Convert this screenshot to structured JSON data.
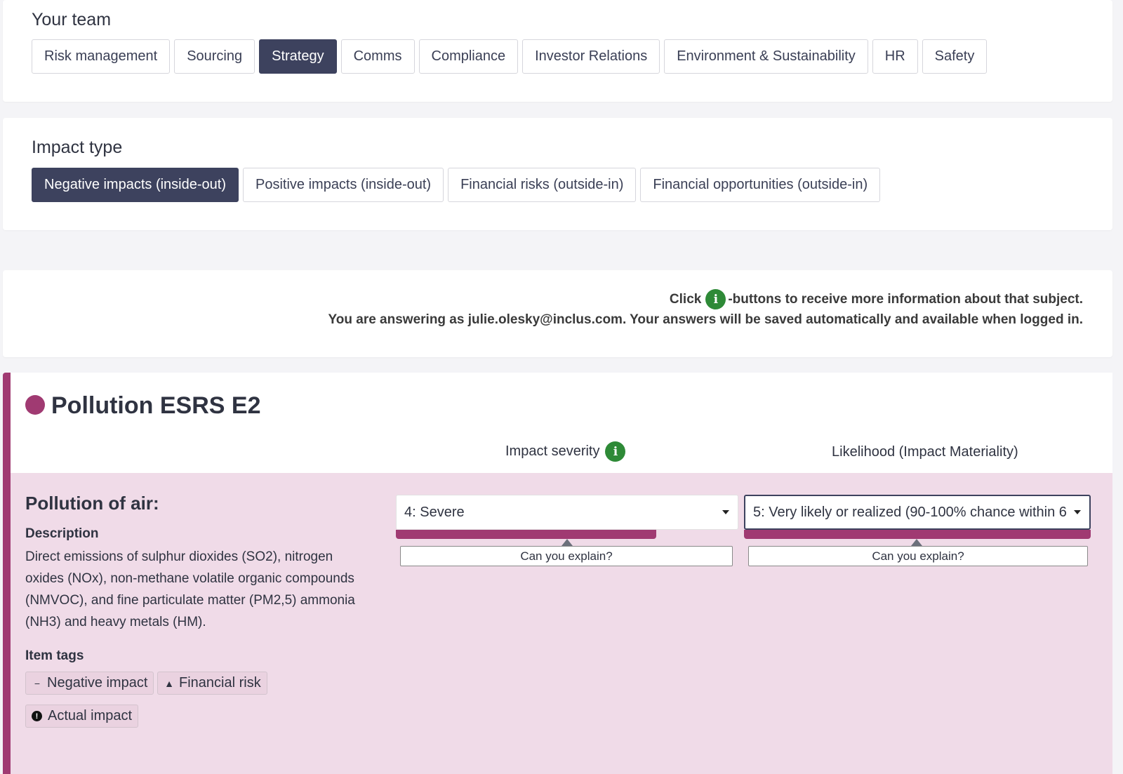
{
  "team": {
    "title": "Your team",
    "buttons": [
      "Risk management",
      "Sourcing",
      "Strategy",
      "Comms",
      "Compliance",
      "Investor Relations",
      "Environment & Sustainability",
      "HR",
      "Safety"
    ],
    "active": "Strategy"
  },
  "impact_type": {
    "title": "Impact type",
    "buttons": [
      "Negative impacts (inside-out)",
      "Positive impacts (inside-out)",
      "Financial risks (outside-in)",
      "Financial opportunities (outside-in)"
    ],
    "active": "Negative impacts (inside-out)"
  },
  "notice": {
    "line1_prefix": "Click",
    "line1_suffix": "-buttons to receive more information about that subject.",
    "line2": "You are answering as julie.olesky@inclus.com. Your answers will be saved automatically and available when logged in."
  },
  "topic": {
    "title": "Pollution ESRS E2",
    "color": "#a03a72",
    "col_severity": "Impact severity",
    "col_likelihood": "Likelihood (Impact Materiality)"
  },
  "item": {
    "title": "Pollution of air:",
    "description_label": "Description",
    "description": "Direct emissions of sulphur dioxides (SO2), nitrogen oxides (NOx), non-methane volatile organic compounds (NMVOC), and fine particulate matter (PM2,5) ammonia (NH3) and heavy metals (HM).",
    "tags_label": "Item tags",
    "tags": [
      {
        "label": "Negative impact",
        "icon": "minus-icon"
      },
      {
        "label": "Financial risk",
        "icon": "warning-triangle-icon"
      },
      {
        "label": "Actual impact",
        "icon": "exclamation-circle-icon"
      }
    ],
    "severity_value": "4: Severe",
    "severity_level": 0.8,
    "likelihood_value": "5: Very likely or realized (90-100% chance within 6",
    "likelihood_level": 1.0,
    "explain_label": "Can you explain?"
  },
  "colors": {
    "active_button": "#3d425e",
    "accent": "#a03a72",
    "info_green": "#2e8a37",
    "item_bg": "#f0dbe8"
  }
}
